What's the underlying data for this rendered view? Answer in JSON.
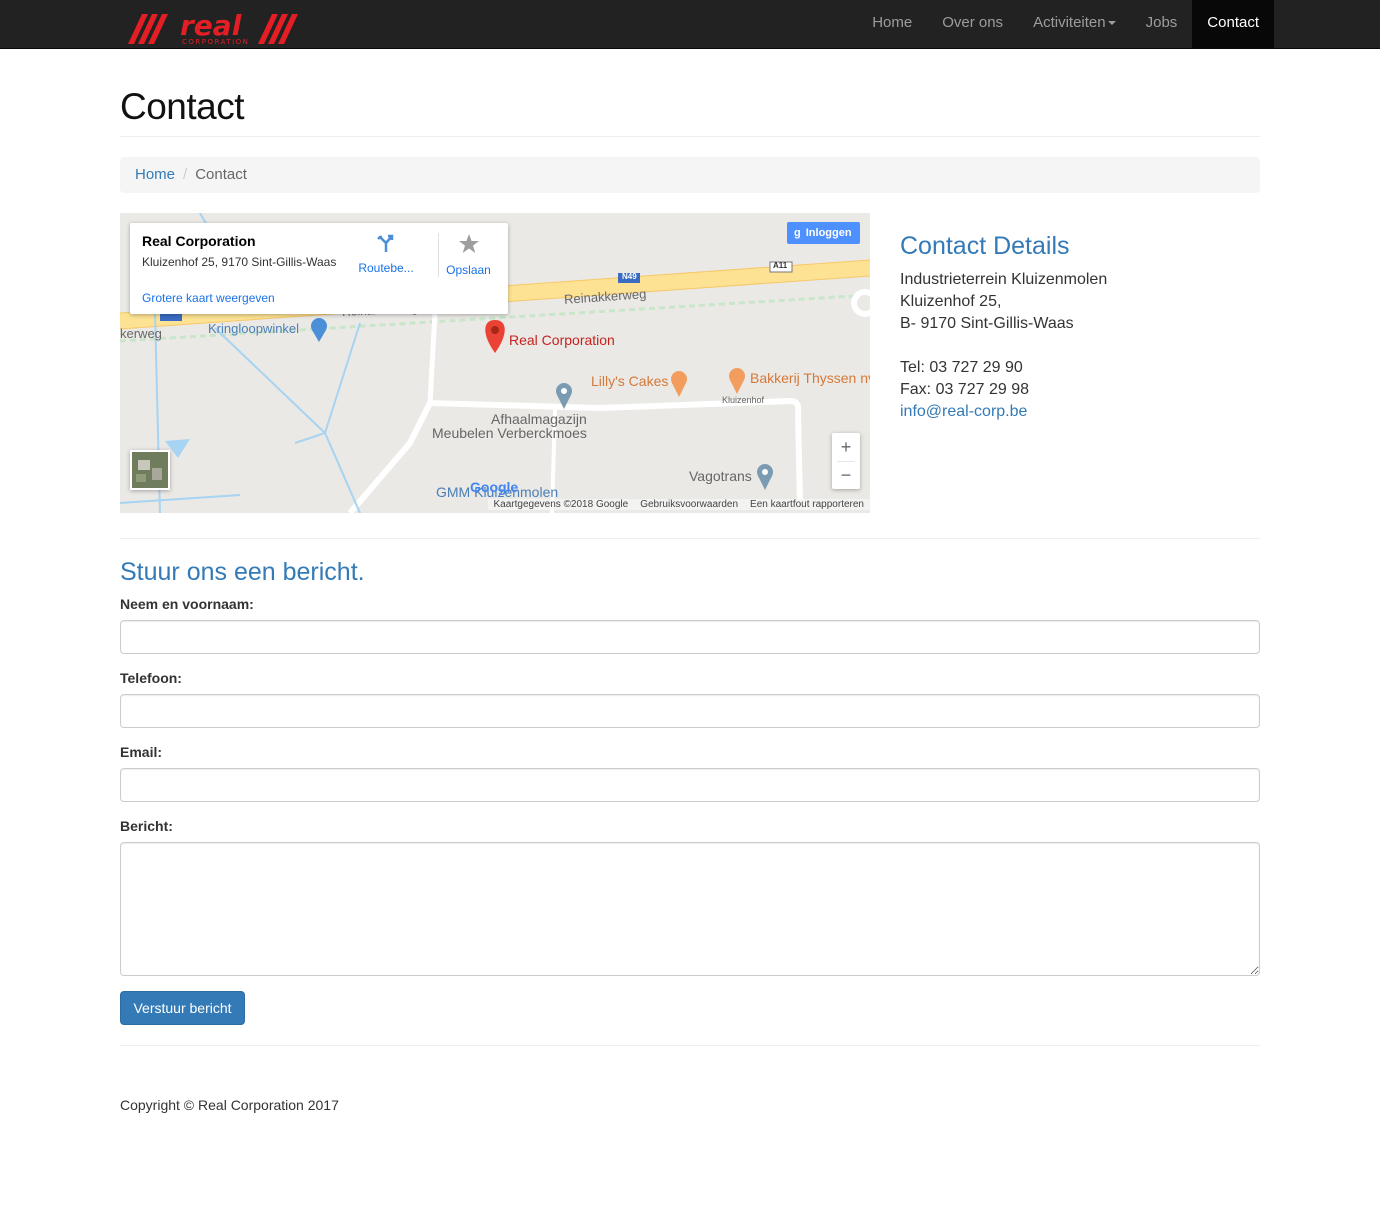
{
  "brand": {
    "logo_text": "real",
    "logo_sub": "CORPORATION"
  },
  "nav": {
    "items": [
      {
        "label": "Home"
      },
      {
        "label": "Over ons"
      },
      {
        "label": "Activiteiten"
      },
      {
        "label": "Jobs"
      },
      {
        "label": "Contact",
        "active": true
      }
    ]
  },
  "page": {
    "title": "Contact"
  },
  "breadcrumb": {
    "home": "Home",
    "separator": "/",
    "current": "Contact"
  },
  "map": {
    "card": {
      "name": "Real Corporation",
      "address": "Kluizenhof 25, 9170 Sint-Gillis-Waas",
      "route_label": "Routebe...",
      "save_label": "Opslaan",
      "larger_map_link": "Grotere kaart weergeven"
    },
    "login_label": "Inloggen",
    "labels": {
      "reinakkerweg": "Reinakkerweg",
      "reinakkerweg2": "Reinakkerweg",
      "kerweg": "kerweg",
      "kringloopwinkel": "Kringloopwinkel",
      "real_corporation": "Real Corporation",
      "lillys_cakes": "Lilly's Cakes",
      "bakkerij": "Bakkerij Thyssen nv",
      "kluizenhof": "Kluizenhof",
      "afhaal1": "Afhaalmagazijn",
      "afhaal2": "Meubelen Verberckmoes",
      "vagotrans": "Vagotrans",
      "gmm": "GMM Kluizenmolen",
      "n49": "N49",
      "a11": "A11",
      "google": "Google"
    },
    "footer": {
      "data": "Kaartgegevens ©2018 Google",
      "terms": "Gebruiksvoorwaarden",
      "report": "Een kaartfout rapporteren"
    }
  },
  "contact_details": {
    "title": "Contact Details",
    "address_line1": "Industrieterrein Kluizenmolen",
    "address_line2": "Kluizenhof 25,",
    "address_line3": "B- 9170 Sint-Gillis-Waas",
    "tel": "Tel: 03 727 29 90",
    "fax": "Fax: 03 727 29 98",
    "email": "info@real-corp.be"
  },
  "form": {
    "title": "Stuur ons een bericht.",
    "name_label": "Neem en voornaam:",
    "phone_label": "Telefoon:",
    "email_label": "Email:",
    "message_label": "Bericht:",
    "name_value": "",
    "phone_value": "",
    "email_value": "",
    "message_value": "",
    "submit_label": "Verstuur bericht"
  },
  "footer": {
    "copyright": "Copyright © Real Corporation 2017"
  },
  "colors": {
    "navbar_bg": "#222222",
    "brand_red": "#e31e24",
    "link_blue": "#337ab7",
    "map_pin": "#ea4335"
  }
}
